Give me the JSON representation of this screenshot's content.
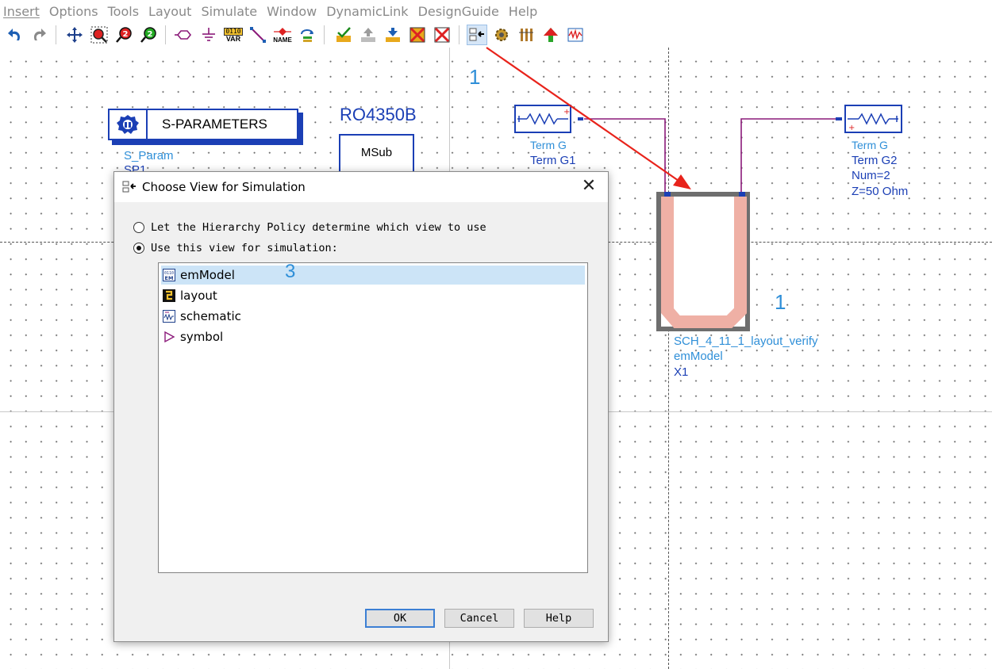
{
  "menubar": {
    "items": [
      "Insert",
      "Options",
      "Tools",
      "Layout",
      "Simulate",
      "Window",
      "DynamicLink",
      "DesignGuide",
      "Help"
    ]
  },
  "toolbar": {
    "icons": [
      "undo-icon",
      "redo-icon",
      "move-icon",
      "zoom-icon",
      "zoom-in-icon",
      "zoom-out-icon",
      "port-icon",
      "ground-icon",
      "var-icon",
      "wire-icon",
      "name-icon",
      "rotate-icon",
      "check-icon",
      "push-icon",
      "pop-icon",
      "deactivate-icon",
      "short-icon",
      "choose-view-icon",
      "simulate-gear-icon",
      "tune-icon",
      "push-up-icon",
      "data-display-icon"
    ],
    "var_label": "0110",
    "var_sub": "VAR",
    "name_label": "NAME"
  },
  "schematic": {
    "sparam_box_label": "S-PARAMETERS",
    "sparam_name": "S_Param",
    "sparam_id": "SP1",
    "substrate_title": "RO4350B",
    "msub_label": "MSub",
    "term1_type": "Term G",
    "term1_name": "Term G1",
    "term2_type": "Term G",
    "term2_name": "Term G2",
    "term2_num": "Num=2",
    "term2_z": "Z=50 Ohm",
    "component_cell": "SCH_4_11_1_layout_verify",
    "component_view": "emModel",
    "component_instance": "X1",
    "annotation_1a": "1",
    "annotation_1b": "1",
    "annotation_3": "3",
    "colors": {
      "schematic_blue": "#2a5bd7",
      "label_blue": "#2f8fd8",
      "wire_purple": "#8b1a7a",
      "arrow_red": "#e8231b",
      "symbol_fill": "#f0b3a7",
      "symbol_border": "#6e6e6e"
    }
  },
  "dialog": {
    "title": "Choose View for Simulation",
    "option_policy": "Let the Hierarchy Policy determine which view to use",
    "option_use_view": "Use this view for simulation:",
    "selected_option": "Use this view for simulation:",
    "views": [
      {
        "label": "emModel",
        "icon": "em-model-icon",
        "selected": true
      },
      {
        "label": "layout",
        "icon": "layout-icon",
        "selected": false
      },
      {
        "label": "schematic",
        "icon": "schematic-icon",
        "selected": false
      },
      {
        "label": "symbol",
        "icon": "symbol-icon",
        "selected": false
      }
    ],
    "ok_label": "OK",
    "cancel_label": "Cancel",
    "help_label": "Help",
    "close_glyph": "✕"
  }
}
